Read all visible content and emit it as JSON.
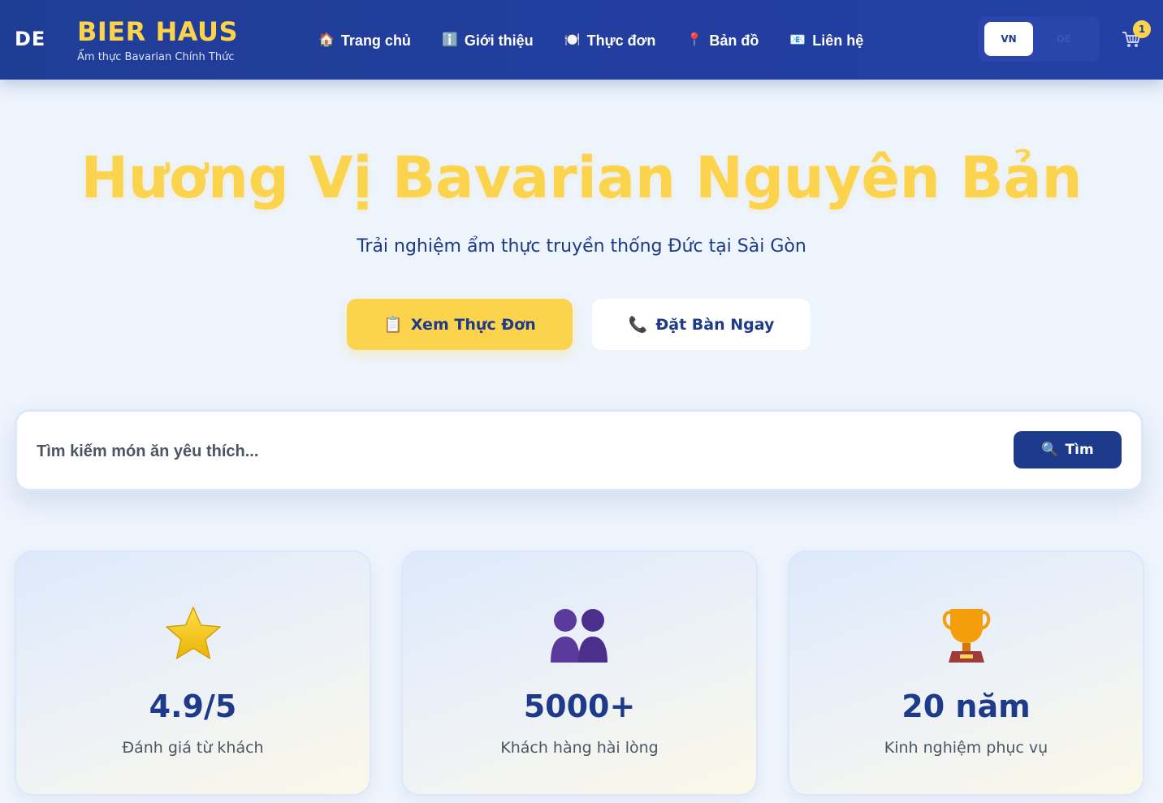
{
  "header": {
    "logo_mark": "DE",
    "brand_name": "BIER HAUS",
    "brand_tagline": "Ẩm thực Bavarian Chính Thức",
    "nav": [
      {
        "icon": "🏠",
        "label": "Trang chủ"
      },
      {
        "icon": "ℹ️",
        "label": "Giới thiệu"
      },
      {
        "icon": "🍽️",
        "label": "Thực đơn"
      },
      {
        "icon": "📍",
        "label": "Bản đồ"
      },
      {
        "icon": "📧",
        "label": "Liên hệ"
      }
    ],
    "lang": {
      "active": "VN",
      "inactive": "DE"
    },
    "cart_count": "1"
  },
  "hero": {
    "title": "Hương Vị Bavarian Nguyên Bản",
    "subtitle": "Trải nghiệm ẩm thực truyền thống Đức tại Sài Gòn",
    "primary_cta": {
      "icon": "📋",
      "label": "Xem Thực Đơn"
    },
    "secondary_cta": {
      "icon": "📞",
      "label": "Đặt Bàn Ngay"
    }
  },
  "search": {
    "placeholder": "Tìm kiếm món ăn yêu thích...",
    "button_icon": "🔍",
    "button_label": "Tìm"
  },
  "stats": [
    {
      "icon": "star-icon",
      "value": "4.9/5",
      "label": "Đánh giá từ khách"
    },
    {
      "icon": "customers-icon",
      "value": "5000+",
      "label": "Khách hàng hài lòng"
    },
    {
      "icon": "trophy-icon",
      "value": "20 năm",
      "label": "Kinh nghiệm phục vụ"
    }
  ],
  "colors": {
    "header_bg": "#203d96",
    "accent_yellow": "#fcd34d",
    "primary_blue": "#1e3a8a",
    "page_bg": "#eef4fc"
  }
}
